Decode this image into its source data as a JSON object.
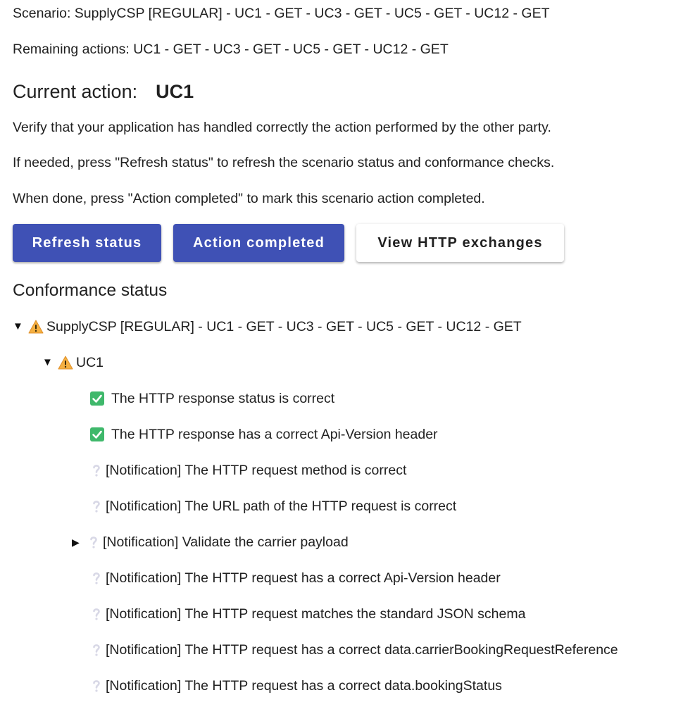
{
  "scenario_line": "Scenario: SupplyCSP [REGULAR] - UC1 - GET - UC3 - GET - UC5 - GET - UC12 - GET",
  "remaining_line": "Remaining actions: UC1 - GET - UC3 - GET - UC5 - GET - UC12 - GET",
  "current_action": {
    "label": "Current action:",
    "value": "UC1"
  },
  "instructions": [
    "Verify that your application has handled correctly the action performed by the other party.",
    "If needed, press \"Refresh status\" to refresh the scenario status and conformance checks.",
    "When done, press \"Action completed\" to mark this scenario action completed."
  ],
  "buttons": {
    "refresh": "Refresh status",
    "complete": "Action completed",
    "http": "View HTTP exchanges"
  },
  "conformance": {
    "title": "Conformance status",
    "root": {
      "label": "SupplyCSP [REGULAR] - UC1 - GET - UC3 - GET - UC5 - GET - UC12 - GET",
      "status": "warning",
      "expanded": true
    },
    "action": {
      "label": "UC1",
      "status": "warning",
      "expanded": true
    },
    "checks": [
      {
        "label": "The HTTP response status is correct",
        "status": "passed"
      },
      {
        "label": "The HTTP response has a correct Api-Version header",
        "status": "passed"
      },
      {
        "label": "[Notification] The HTTP request method is correct",
        "status": "unknown"
      },
      {
        "label": "[Notification] The URL path of the HTTP request is correct",
        "status": "unknown"
      },
      {
        "label": "[Notification] Validate the carrier payload",
        "status": "unknown",
        "expandable": true
      },
      {
        "label": "[Notification] The HTTP request has a correct Api-Version header",
        "status": "unknown"
      },
      {
        "label": "[Notification] The HTTP request matches the standard JSON schema",
        "status": "unknown"
      },
      {
        "label": "[Notification] The HTTP request has a correct data.carrierBookingRequestReference",
        "status": "unknown"
      },
      {
        "label": "[Notification] The HTTP request has a correct data.bookingStatus",
        "status": "unknown"
      }
    ]
  },
  "icons": {
    "warning": "warning-icon",
    "passed": "check-mark-icon",
    "unknown": "question-mark-icon",
    "expanded": "triangle-down-icon",
    "collapsed": "triangle-right-icon"
  },
  "colors": {
    "primary_button": "#3f51b5",
    "primary_button_text": "#ffffff",
    "secondary_button": "#ffffff",
    "text": "#212121",
    "check": "#3fb86b",
    "warning": "#f5b041"
  }
}
